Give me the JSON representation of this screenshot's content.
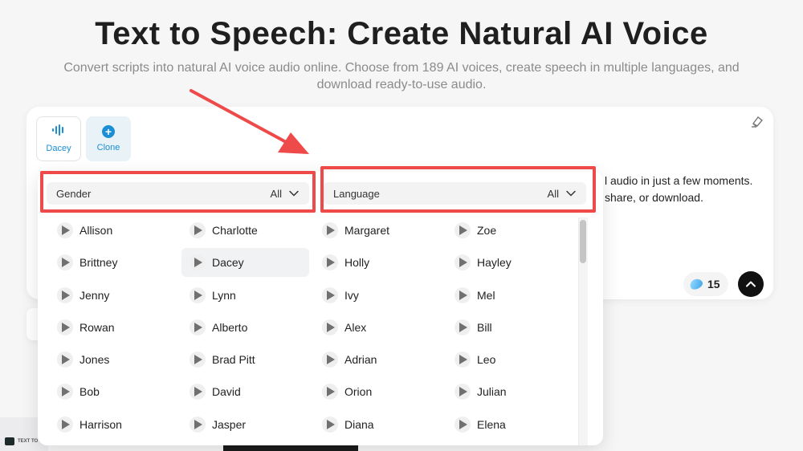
{
  "hero": {
    "title": "Text to Speech: Create Natural AI Voice",
    "subtitle_line1": "Convert scripts into natural AI voice audio online. Choose from 189 AI voices, create speech in multiple languages, and",
    "subtitle_line2": "download ready-to-use audio."
  },
  "editor": {
    "voice_tile_label": "Dacey",
    "clone_label": "Clone",
    "text_line1": "l audio in just a few moments.",
    "text_line2": "share, or download.",
    "credits": "15"
  },
  "filters": {
    "gender": {
      "label": "Gender",
      "value": "All"
    },
    "language": {
      "label": "Language",
      "value": "All"
    }
  },
  "voices": [
    "Allison",
    "Charlotte",
    "Margaret",
    "Zoe",
    "Brittney",
    "Dacey",
    "Holly",
    "Hayley",
    "Jenny",
    "Lynn",
    "Ivy",
    "Mel",
    "Rowan",
    "Alberto",
    "Alex",
    "Bill",
    "Jones",
    "Brad Pitt",
    "Adrian",
    "Leo",
    "Bob",
    "David",
    "Orion",
    "Julian",
    "Harrison",
    "Jasper",
    "Diana",
    "Elena"
  ],
  "selected_voice": "Dacey",
  "footer": {
    "logo_text": "TEXT TO"
  },
  "colors": {
    "accent": "#1a8fd6",
    "highlight": "#ef4a4a",
    "send_button": "#111111"
  },
  "icons": {
    "voice_tile": "waveform-icon",
    "clone": "plus-circle-icon",
    "eraser": "eraser-icon",
    "credits": "droplet-icon",
    "send": "chevron-up-icon",
    "voice_item": "play-icon",
    "filter": "chevron-down-icon"
  }
}
